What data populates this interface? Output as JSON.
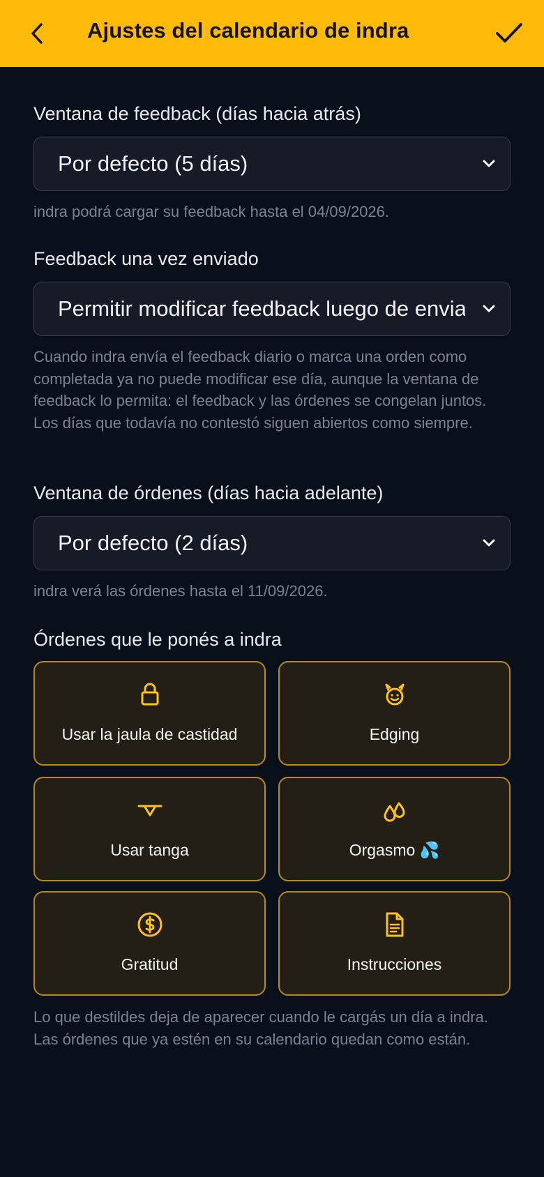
{
  "header": {
    "title": "Ajustes del calendario de indra",
    "back_icon": "chevron-left-icon",
    "confirm_icon": "check-icon"
  },
  "colors": {
    "accent": "#ffba0a",
    "background": "#0a0f1c",
    "card_border": "#b88a14",
    "card_bg": "#241f16"
  },
  "feedback_window": {
    "label": "Ventana de feedback (días hacia atrás)",
    "value": "Por defecto (5 días)",
    "help": "indra podrá cargar su feedback hasta el 04/09/2026."
  },
  "feedback_once_sent": {
    "label": "Feedback una vez enviado",
    "value": "Permitir modificar feedback luego de enviarlo",
    "help": "Cuando indra envía el feedback diario o marca una orden como completada ya no puede modificar ese día, aunque la ventana de feedback lo permita: el feedback y las órdenes se congelan juntos. Los días que todavía no contestó siguen abiertos como siempre."
  },
  "orders_window": {
    "label": "Ventana de órdenes (días hacia adelante)",
    "value": "Por defecto (2 días)",
    "help": "indra verá las órdenes hasta el 11/09/2026."
  },
  "orders": {
    "label": "Órdenes que le ponés a indra",
    "items": [
      {
        "label": "Usar la jaula de castidad",
        "icon": "lock-icon"
      },
      {
        "label": "Edging",
        "icon": "devil-face-icon"
      },
      {
        "label": "Usar tanga",
        "icon": "thong-icon"
      },
      {
        "label": "Orgasmo 💦",
        "icon": "droplets-icon"
      },
      {
        "label": "Gratitud",
        "icon": "dollar-circle-icon"
      },
      {
        "label": "Instrucciones",
        "icon": "document-icon"
      }
    ],
    "help": "Lo que destildes deja de aparecer cuando le cargás un día a indra. Las órdenes que ya estén en su calendario quedan como están."
  }
}
